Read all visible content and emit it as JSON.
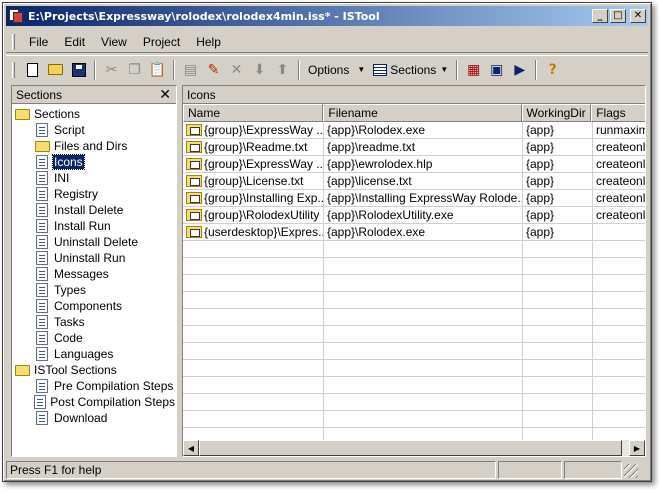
{
  "window": {
    "title": "E:\\Projects\\Expressway\\rolodex\\rolodex4min.iss* - ISTool",
    "controls": {
      "minimize": "_",
      "maximize": "□",
      "close": "✕"
    }
  },
  "menu": [
    "File",
    "Edit",
    "View",
    "Project",
    "Help"
  ],
  "toolbar": {
    "options_label": "Options",
    "sections_label": "Sections"
  },
  "sections_pane": {
    "title": "Sections",
    "close": "✕",
    "tree": [
      {
        "label": "Sections",
        "level": 0,
        "icon": "folder-open-icon"
      },
      {
        "label": "Script",
        "level": 1,
        "icon": "script-icon"
      },
      {
        "label": "Files and Dirs",
        "level": 1,
        "icon": "folder-icon"
      },
      {
        "label": "Icons",
        "level": 1,
        "icon": "icons-icon",
        "selected": true
      },
      {
        "label": "INI",
        "level": 1,
        "icon": "ini-icon"
      },
      {
        "label": "Registry",
        "level": 1,
        "icon": "registry-icon"
      },
      {
        "label": "Install Delete",
        "level": 1,
        "icon": "install-delete-icon"
      },
      {
        "label": "Install Run",
        "level": 1,
        "icon": "install-run-icon"
      },
      {
        "label": "Uninstall Delete",
        "level": 1,
        "icon": "uninstall-delete-icon"
      },
      {
        "label": "Uninstall Run",
        "level": 1,
        "icon": "uninstall-run-icon"
      },
      {
        "label": "Messages",
        "level": 1,
        "icon": "messages-icon"
      },
      {
        "label": "Types",
        "level": 1,
        "icon": "types-icon"
      },
      {
        "label": "Components",
        "level": 1,
        "icon": "components-icon"
      },
      {
        "label": "Tasks",
        "level": 1,
        "icon": "tasks-icon"
      },
      {
        "label": "Code",
        "level": 1,
        "icon": "code-icon"
      },
      {
        "label": "Languages",
        "level": 1,
        "icon": "languages-icon"
      },
      {
        "label": "ISTool Sections",
        "level": 0,
        "icon": "folder-open-icon"
      },
      {
        "label": "Pre Compilation Steps",
        "level": 1,
        "icon": "pre-compilation-icon"
      },
      {
        "label": "Post Compilation Steps",
        "level": 1,
        "icon": "post-compilation-icon"
      },
      {
        "label": "Download",
        "level": 1,
        "icon": "download-icon"
      }
    ]
  },
  "icons_pane": {
    "title": "Icons",
    "columns": [
      "Name",
      "Filename",
      "WorkingDir",
      "Flags"
    ],
    "rows": [
      [
        "{group}\\ExpressWay ...",
        "{app}\\Rolodex.exe",
        "{app}",
        "runmaxim"
      ],
      [
        "{group}\\Readme.txt",
        "{app}\\readme.txt",
        "{app}",
        "createonl"
      ],
      [
        "{group}\\ExpressWay ...",
        "{app}\\ewrolodex.hlp",
        "{app}",
        "createonl"
      ],
      [
        "{group}\\License.txt",
        "{app}\\license.txt",
        "{app}",
        "createonl"
      ],
      [
        "{group}\\Installing Exp...",
        "{app}\\Installing ExpressWay Rolode...",
        "{app}",
        "createonl"
      ],
      [
        "{group}\\RolodexUtility",
        "{app}\\RolodexUtility.exe",
        "{app}",
        "createonl"
      ],
      [
        "{userdesktop}\\Expres...",
        "{app}\\Rolodex.exe",
        "{app}",
        ""
      ]
    ]
  },
  "status": {
    "text": "Press F1 for help"
  }
}
